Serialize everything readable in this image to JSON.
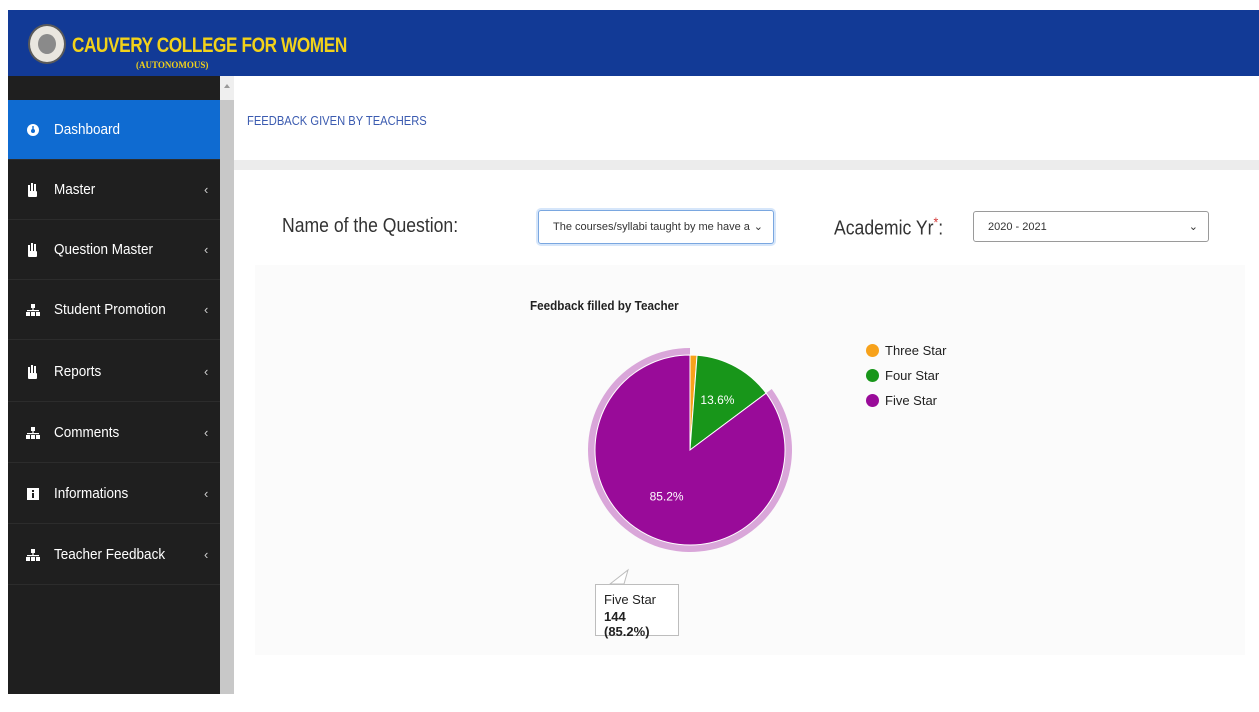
{
  "header": {
    "college_name": "CAUVERY COLLEGE FOR WOMEN",
    "college_sub": "(AUTONOMOUS)"
  },
  "sidebar": {
    "items": [
      {
        "label": "Dashboard",
        "icon": "dashboard-icon",
        "active": true
      },
      {
        "label": "Master",
        "icon": "hand-icon"
      },
      {
        "label": "Question Master",
        "icon": "hand-icon"
      },
      {
        "label": "Student Promotion",
        "icon": "sitemap-icon"
      },
      {
        "label": "Reports",
        "icon": "hand-icon"
      },
      {
        "label": "Comments",
        "icon": "sitemap-icon"
      },
      {
        "label": "Informations",
        "icon": "info-icon"
      },
      {
        "label": "Teacher Feedback",
        "icon": "sitemap-icon"
      }
    ]
  },
  "main": {
    "title": "FEEDBACK GIVEN BY TEACHERS",
    "question_label": "Name of the Question:",
    "question_value": "The courses/syllabi taught by me have a",
    "academic_label": "Academic Yr",
    "academic_suffix": ":",
    "academic_value": "2020 - 2021"
  },
  "chart_data": {
    "type": "pie",
    "title": "Feedback filled by Teacher",
    "categories": [
      "Three Star",
      "Four Star",
      "Five Star"
    ],
    "values": [
      2,
      23,
      144
    ],
    "percent_labels": [
      "",
      "13.6%",
      "85.2%"
    ],
    "colors": [
      "#f7a21b",
      "#18961a",
      "#990b99"
    ],
    "legend_position": "right",
    "tooltip": {
      "label": "Five Star",
      "value": "144 (85.2%)"
    }
  }
}
